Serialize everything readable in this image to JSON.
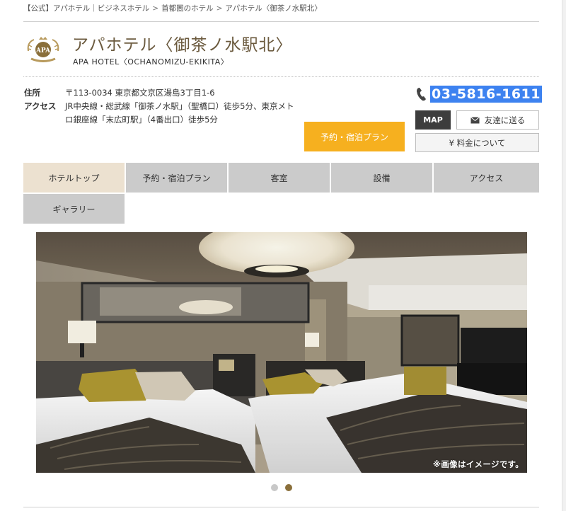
{
  "breadcrumb": [
    "【公式】アパホテル｜ビジネスホテル",
    "首都圏のホテル",
    "アパホテル〈御茶ノ水駅北〉"
  ],
  "breadcrumb_separator": ">",
  "logo_text": "APA",
  "hotel": {
    "name": "アパホテル〈御茶ノ水駅北〉",
    "name_en": "APA HOTEL〈OCHANOMIZU-EKIKITA〉"
  },
  "info": {
    "address_label": "住所",
    "address": "〒113-0034 東京都文京区湯島3丁目1-6",
    "access_label": "アクセス",
    "access": "JR中央線・総武線「御茶ノ水駅」（聖橋口）徒歩5分、東京メトロ銀座線「末広町駅」（4番出口）徒歩5分"
  },
  "phone": "03-5816-1611",
  "buttons": {
    "reserve": "予約・宿泊プラン",
    "map": "MAP",
    "send_friend": "友達に送る",
    "price": "¥ 料金について"
  },
  "nav": [
    "ホテルトップ",
    "予約・宿泊プラン",
    "客室",
    "設備",
    "アクセス",
    "ギャラリー"
  ],
  "hero": {
    "caption": "※画像はイメージです。"
  },
  "carousel": {
    "slides": 2,
    "active": 2
  },
  "colors": {
    "brand_gold": "#6b5a3e",
    "reserve_orange": "#f6b01f",
    "nav_gray": "#cbcbcb",
    "nav_active": "#ece1d0",
    "phone_highlight": "#3d82f0"
  }
}
